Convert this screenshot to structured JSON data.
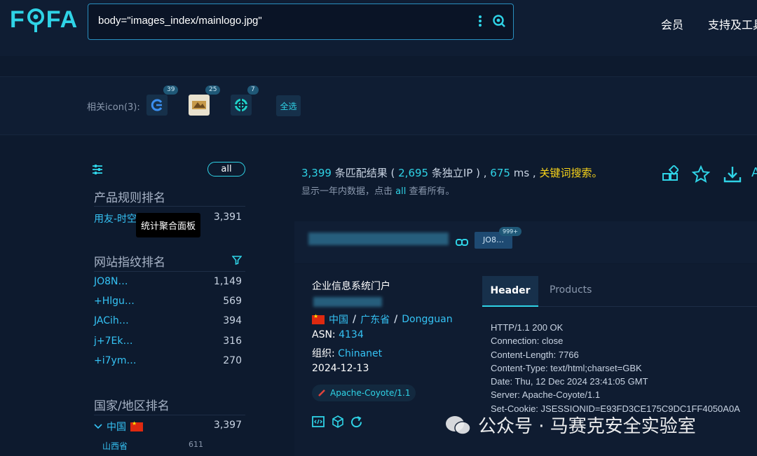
{
  "header": {
    "logo": "FOFA",
    "query": "body=\"images_index/mainlogo.jpg\"",
    "nav": [
      "会员",
      "支持及工具"
    ]
  },
  "related_icons": {
    "label": "相关icon(3):",
    "items": [
      {
        "count": "39"
      },
      {
        "count": "25"
      },
      {
        "count": "7"
      }
    ],
    "select_all": "全选"
  },
  "sidebar": {
    "all_label": "all",
    "tooltip": "统计聚合面板",
    "product_rank": {
      "title": "产品规则排名",
      "rows": [
        {
          "name": "用友-时空",
          "count": "3,391"
        }
      ]
    },
    "fingerprint_rank": {
      "title": "网站指纹排名",
      "rows": [
        {
          "name": "JO8N…",
          "count": "1,149"
        },
        {
          "name": "+Hlgu…",
          "count": "569"
        },
        {
          "name": "JACih…",
          "count": "394"
        },
        {
          "name": "j+7Ek…",
          "count": "316"
        },
        {
          "name": "+i7ym…",
          "count": "270"
        }
      ]
    },
    "country_rank": {
      "title": "国家/地区排名",
      "rows": [
        {
          "name": "中国",
          "count": "3,397"
        }
      ],
      "sub_rows": [
        {
          "name": "山西省",
          "count": "611"
        }
      ]
    }
  },
  "results": {
    "total": "3,399",
    "total_label": "条匹配结果 (",
    "ips": "2,695",
    "ips_label": "条独立IP ) ,",
    "time": "675",
    "time_unit": "ms ,",
    "keyword_search": "关键词搜索。",
    "sub_pre": "显示一年内数据，点击",
    "sub_all": "all",
    "sub_post": "查看所有。"
  },
  "card": {
    "tag": "JO8…",
    "tag_badge": "999+",
    "title": "企业信息系统门户",
    "country": "中国",
    "province": "广东省",
    "city": "Dongguan",
    "asn_label": "ASN:",
    "asn": "4134",
    "org_label": "组织:",
    "org": "Chinanet",
    "date": "2024-12-13",
    "server_tag": "Apache-Coyote/1.1",
    "tabs": [
      "Header",
      "Products"
    ],
    "http_header": "HTTP/1.1 200 OK\nConnection: close\nContent-Length: 7766\nContent-Type: text/html;charset=GBK\nDate: Thu, 12 Dec 2024 23:41:05 GMT\nServer: Apache-Coyote/1.1\nSet-Cookie: JSESSIONID=E93FD3CE175C9DC1FF4050A0A"
  },
  "watermark": "公众号 · 马赛克安全实验室",
  "colors": {
    "accent": "#2fd3e6",
    "link": "#35c3f5",
    "keyword": "#f7d31a",
    "background": "#0d1a2e"
  }
}
